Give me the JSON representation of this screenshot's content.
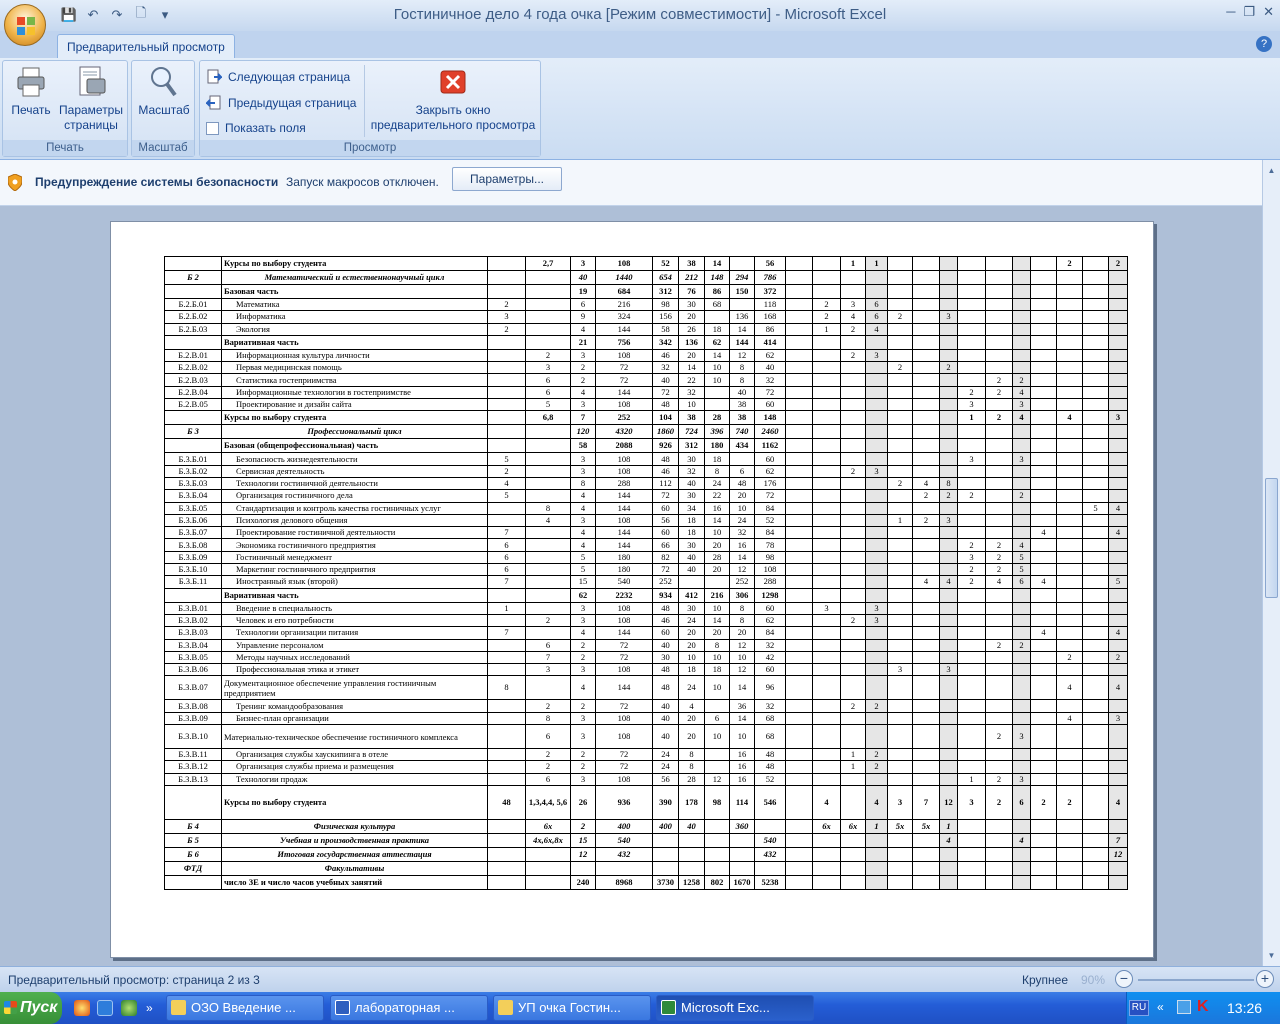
{
  "app": {
    "title": "Гостиничное дело 4 года очка  [Режим совместимости] - Microsoft Excel",
    "help": "?"
  },
  "ribbon": {
    "tab": "Предварительный просмотр",
    "groups": {
      "print": "Печать",
      "scale": "Масштаб",
      "view": "Просмотр"
    },
    "buttons": {
      "print": "Печать",
      "page_setup_1": "Параметры",
      "page_setup_2": "страницы",
      "zoom": "Масштаб",
      "next_page": "Следующая страница",
      "prev_page": "Предыдущая страница",
      "show_margins": "Показать поля",
      "close_1": "Закрыть окно",
      "close_2": "предварительного просмотра"
    }
  },
  "security": {
    "title": "Предупреждение системы безопасности",
    "text": "Запуск макросов отключен.",
    "button": "Параметры..."
  },
  "rows": [
    {
      "s": "b",
      "c": [
        "",
        "Курсы по выбору студента",
        "",
        "2,7",
        "3",
        "108",
        "52",
        "38",
        "14",
        "",
        "56",
        "",
        "",
        "1",
        "1",
        "",
        "",
        "",
        "",
        "",
        "",
        "",
        "2",
        "",
        "2"
      ]
    },
    {
      "s": "it",
      "c": [
        "Б 2",
        "Математический и естественнонаучный цикл",
        "",
        "",
        "40",
        "1440",
        "654",
        "212",
        "148",
        "294",
        "786",
        "",
        "",
        "",
        "",
        "",
        "",
        "",
        "",
        "",
        "",
        "",
        "",
        "",
        ""
      ]
    },
    {
      "s": "b",
      "c": [
        "",
        "Базовая часть",
        "",
        "",
        "19",
        "684",
        "312",
        "76",
        "86",
        "150",
        "372",
        "",
        "",
        "",
        "",
        "",
        "",
        "",
        "",
        "",
        "",
        "",
        "",
        "",
        ""
      ]
    },
    {
      "s": "",
      "c": [
        "Б.2.Б.01",
        "Математика",
        "2",
        "",
        "6",
        "216",
        "98",
        "30",
        "68",
        "",
        "118",
        "",
        "2",
        "3",
        "6",
        "",
        "",
        "",
        "",
        "",
        "",
        "",
        "",
        "",
        ""
      ]
    },
    {
      "s": "",
      "c": [
        "Б.2.Б.02",
        "Информатика",
        "3",
        "",
        "9",
        "324",
        "156",
        "20",
        "",
        "136",
        "168",
        "",
        "2",
        "4",
        "6",
        "2",
        "",
        "3",
        "",
        "",
        "",
        "",
        "",
        "",
        ""
      ]
    },
    {
      "s": "",
      "c": [
        "Б.2.Б.03",
        "Экология",
        "2",
        "",
        "4",
        "144",
        "58",
        "26",
        "18",
        "14",
        "86",
        "",
        "1",
        "2",
        "4",
        "",
        "",
        "",
        "",
        "",
        "",
        "",
        "",
        "",
        ""
      ]
    },
    {
      "s": "b",
      "c": [
        "",
        "Вариативная часть",
        "",
        "",
        "21",
        "756",
        "342",
        "136",
        "62",
        "144",
        "414",
        "",
        "",
        "",
        "",
        "",
        "",
        "",
        "",
        "",
        "",
        "",
        "",
        "",
        ""
      ]
    },
    {
      "s": "",
      "c": [
        "Б.2.В.01",
        "Информационная культура личности",
        "",
        "2",
        "3",
        "108",
        "46",
        "20",
        "14",
        "12",
        "62",
        "",
        "",
        "2",
        "3",
        "",
        "",
        "",
        "",
        "",
        "",
        "",
        "",
        "",
        ""
      ]
    },
    {
      "s": "",
      "c": [
        "Б.2.В.02",
        "Первая медицинская помощь",
        "",
        "3",
        "2",
        "72",
        "32",
        "14",
        "10",
        "8",
        "40",
        "",
        "",
        "",
        "",
        "2",
        "",
        "2",
        "",
        "",
        "",
        "",
        "",
        "",
        ""
      ]
    },
    {
      "s": "",
      "c": [
        "Б.2.В.03",
        "Статистика гостеприимства",
        "",
        "6",
        "2",
        "72",
        "40",
        "22",
        "10",
        "8",
        "32",
        "",
        "",
        "",
        "",
        "",
        "",
        "",
        "",
        "2",
        "2",
        "",
        "",
        "",
        ""
      ]
    },
    {
      "s": "",
      "c": [
        "Б.2.В.04",
        "Информационные технологии в гостеприимстве",
        "",
        "6",
        "4",
        "144",
        "72",
        "32",
        "",
        "40",
        "72",
        "",
        "",
        "",
        "",
        "",
        "",
        "",
        "2",
        "2",
        "4",
        "",
        "",
        "",
        ""
      ]
    },
    {
      "s": "",
      "c": [
        "Б.2.В.05",
        "Проектирование и дизайн сайта",
        "",
        "5",
        "3",
        "108",
        "48",
        "10",
        "",
        "38",
        "60",
        "",
        "",
        "",
        "",
        "",
        "",
        "",
        "3",
        "",
        "3",
        "",
        "",
        "",
        ""
      ]
    },
    {
      "s": "b",
      "c": [
        "",
        "Курсы по выбору студента",
        "",
        "6,8",
        "7",
        "252",
        "104",
        "38",
        "28",
        "38",
        "148",
        "",
        "",
        "",
        "",
        "",
        "",
        "",
        "1",
        "2",
        "4",
        "",
        "4",
        "",
        "3"
      ]
    },
    {
      "s": "it",
      "c": [
        "Б 3",
        "Профессиональный цикл",
        "",
        "",
        "120",
        "4320",
        "1860",
        "724",
        "396",
        "740",
        "2460",
        "",
        "",
        "",
        "",
        "",
        "",
        "",
        "",
        "",
        "",
        "",
        "",
        "",
        ""
      ]
    },
    {
      "s": "b",
      "c": [
        "",
        "Базовая (общепрофессиональная) часть",
        "",
        "",
        "58",
        "2088",
        "926",
        "312",
        "180",
        "434",
        "1162",
        "",
        "",
        "",
        "",
        "",
        "",
        "",
        "",
        "",
        "",
        "",
        "",
        "",
        ""
      ]
    },
    {
      "s": "",
      "c": [
        "Б.3.Б.01",
        "Безопасность жизнедеятельности",
        "5",
        "",
        "3",
        "108",
        "48",
        "30",
        "18",
        "",
        "60",
        "",
        "",
        "",
        "",
        "",
        "",
        "",
        "3",
        "",
        "3",
        "",
        "",
        "",
        ""
      ]
    },
    {
      "s": "",
      "c": [
        "Б.3.Б.02",
        "Сервисная деятельность",
        "2",
        "",
        "3",
        "108",
        "46",
        "32",
        "8",
        "6",
        "62",
        "",
        "",
        "2",
        "3",
        "",
        "",
        "",
        "",
        "",
        "",
        "",
        "",
        "",
        ""
      ]
    },
    {
      "s": "",
      "c": [
        "Б.3.Б.03",
        "Технологии гостиничной деятельности",
        "4",
        "",
        "8",
        "288",
        "112",
        "40",
        "24",
        "48",
        "176",
        "",
        "",
        "",
        "",
        "2",
        "4",
        "8",
        "",
        "",
        "",
        "",
        "",
        "",
        ""
      ]
    },
    {
      "s": "",
      "c": [
        "Б.3.Б.04",
        "Организация гостиничного дела",
        "5",
        "",
        "4",
        "144",
        "72",
        "30",
        "22",
        "20",
        "72",
        "",
        "",
        "",
        "",
        "",
        "2",
        "2",
        "2",
        "",
        "2",
        "",
        "",
        "",
        ""
      ]
    },
    {
      "s": "",
      "c": [
        "Б.3.Б.05",
        "Стандартизация и контроль качества гостиничных услуг",
        "",
        "8",
        "4",
        "144",
        "60",
        "34",
        "16",
        "10",
        "84",
        "",
        "",
        "",
        "",
        "",
        "",
        "",
        "",
        "",
        "",
        "",
        "",
        "5",
        "4"
      ]
    },
    {
      "s": "",
      "c": [
        "Б.3.Б.06",
        "Психология делового общения",
        "",
        "4",
        "3",
        "108",
        "56",
        "18",
        "14",
        "24",
        "52",
        "",
        "",
        "",
        "",
        "1",
        "2",
        "3",
        "",
        "",
        "",
        "",
        "",
        "",
        ""
      ]
    },
    {
      "s": "",
      "c": [
        "Б.3.Б.07",
        "Проектирование гостиничной деятельности",
        "7",
        "",
        "4",
        "144",
        "60",
        "18",
        "10",
        "32",
        "84",
        "",
        "",
        "",
        "",
        "",
        "",
        "",
        "",
        "",
        "",
        "4",
        "",
        "",
        "4"
      ]
    },
    {
      "s": "",
      "c": [
        "Б.3.Б.08",
        "Экономика гостиничного предприятия",
        "6",
        "",
        "4",
        "144",
        "66",
        "30",
        "20",
        "16",
        "78",
        "",
        "",
        "",
        "",
        "",
        "",
        "",
        "2",
        "2",
        "4",
        "",
        "",
        "",
        ""
      ]
    },
    {
      "s": "",
      "c": [
        "Б.3.Б.09",
        "Гостиничный менеджмент",
        "6",
        "",
        "5",
        "180",
        "82",
        "40",
        "28",
        "14",
        "98",
        "",
        "",
        "",
        "",
        "",
        "",
        "",
        "3",
        "2",
        "5",
        "",
        "",
        "",
        ""
      ]
    },
    {
      "s": "",
      "c": [
        "Б.3.Б.10",
        "Маркетинг гостиничного предприятия",
        "6",
        "",
        "5",
        "180",
        "72",
        "40",
        "20",
        "12",
        "108",
        "",
        "",
        "",
        "",
        "",
        "",
        "",
        "2",
        "2",
        "5",
        "",
        "",
        "",
        ""
      ]
    },
    {
      "s": "",
      "c": [
        "Б.3.Б.11",
        "Иностранный язык (второй)",
        "7",
        "",
        "15",
        "540",
        "252",
        "",
        "",
        "252",
        "288",
        "",
        "",
        "",
        "",
        "",
        "4",
        "4",
        "2",
        "4",
        "6",
        "4",
        "",
        "",
        "5"
      ]
    },
    {
      "s": "b",
      "c": [
        "",
        "Вариативная часть",
        "",
        "",
        "62",
        "2232",
        "934",
        "412",
        "216",
        "306",
        "1298",
        "",
        "",
        "",
        "",
        "",
        "",
        "",
        "",
        "",
        "",
        "",
        "",
        "",
        ""
      ]
    },
    {
      "s": "",
      "c": [
        "Б.3.В.01",
        "Введение в специальность",
        "1",
        "",
        "3",
        "108",
        "48",
        "30",
        "10",
        "8",
        "60",
        "",
        "3",
        "",
        "3",
        "",
        "",
        "",
        "",
        "",
        "",
        "",
        "",
        "",
        ""
      ]
    },
    {
      "s": "",
      "c": [
        "Б.3.В.02",
        "Человек и его потребности",
        "",
        "2",
        "3",
        "108",
        "46",
        "24",
        "14",
        "8",
        "62",
        "",
        "",
        "2",
        "3",
        "",
        "",
        "",
        "",
        "",
        "",
        "",
        "",
        "",
        ""
      ]
    },
    {
      "s": "",
      "c": [
        "Б.3.В.03",
        "Технологии организации питания",
        "7",
        "",
        "4",
        "144",
        "60",
        "20",
        "20",
        "20",
        "84",
        "",
        "",
        "",
        "",
        "",
        "",
        "",
        "",
        "",
        "",
        "4",
        "",
        "",
        "4"
      ]
    },
    {
      "s": "",
      "c": [
        "Б.3.В.04",
        "Управление персоналом",
        "",
        "6",
        "2",
        "72",
        "40",
        "20",
        "8",
        "12",
        "32",
        "",
        "",
        "",
        "",
        "",
        "",
        "",
        "",
        "2",
        "2",
        "",
        "",
        "",
        ""
      ]
    },
    {
      "s": "",
      "c": [
        "Б.3.В.05",
        "Методы научных исследований",
        "",
        "7",
        "2",
        "72",
        "30",
        "10",
        "10",
        "10",
        "42",
        "",
        "",
        "",
        "",
        "",
        "",
        "",
        "",
        "",
        "",
        "",
        "2",
        "",
        "2"
      ]
    },
    {
      "s": "",
      "c": [
        "Б.3.В.06",
        "Профессиональная этика и этикет",
        "",
        "3",
        "3",
        "108",
        "48",
        "18",
        "18",
        "12",
        "60",
        "",
        "",
        "",
        "",
        "3",
        "",
        "3",
        "",
        "",
        "",
        "",
        "",
        "",
        ""
      ]
    },
    {
      "s": "tall",
      "c": [
        "Б.3.В.07",
        "Документационное обеспечение управления гостиничным предприятием",
        "8",
        "",
        "4",
        "144",
        "48",
        "24",
        "10",
        "14",
        "96",
        "",
        "",
        "",
        "",
        "",
        "",
        "",
        "",
        "",
        "",
        "",
        "4",
        "",
        "4"
      ]
    },
    {
      "s": "",
      "c": [
        "Б.3.В.08",
        "Тренинг командообразования",
        "",
        "2",
        "2",
        "72",
        "40",
        "4",
        "",
        "36",
        "32",
        "",
        "",
        "2",
        "2",
        "",
        "",
        "",
        "",
        "",
        "",
        "",
        "",
        "",
        ""
      ]
    },
    {
      "s": "",
      "c": [
        "Б.3.В.09",
        "Бизнес-план организации",
        "",
        "8",
        "3",
        "108",
        "40",
        "20",
        "6",
        "14",
        "68",
        "",
        "",
        "",
        "",
        "",
        "",
        "",
        "",
        "",
        "",
        "",
        "4",
        "",
        "3"
      ]
    },
    {
      "s": "tall",
      "c": [
        "Б.3.В.10",
        "Материально-техническое обеспечение гостиничного комплекса",
        "",
        "6",
        "3",
        "108",
        "40",
        "20",
        "10",
        "10",
        "68",
        "",
        "",
        "",
        "",
        "",
        "",
        "",
        "",
        "2",
        "3",
        "",
        "",
        "",
        ""
      ]
    },
    {
      "s": "",
      "c": [
        "Б.3.В.11",
        "Организация службы хаускипинга в отеле",
        "",
        "2",
        "2",
        "72",
        "24",
        "8",
        "",
        "16",
        "48",
        "",
        "",
        "1",
        "2",
        "",
        "",
        "",
        "",
        "",
        "",
        "",
        "",
        "",
        ""
      ]
    },
    {
      "s": "",
      "c": [
        "Б.3.В.12",
        "Организация службы приема и размещения",
        "",
        "2",
        "2",
        "72",
        "24",
        "8",
        "",
        "16",
        "48",
        "",
        "",
        "1",
        "2",
        "",
        "",
        "",
        "",
        "",
        "",
        "",
        "",
        "",
        ""
      ]
    },
    {
      "s": "",
      "c": [
        "Б.3.В.13",
        "Технологии продаж",
        "",
        "6",
        "3",
        "108",
        "56",
        "28",
        "12",
        "16",
        "52",
        "",
        "",
        "",
        "",
        "",
        "",
        "",
        "1",
        "2",
        "3",
        "",
        "",
        "",
        ""
      ]
    },
    {
      "s": "big",
      "c": [
        "",
        "Курсы по выбору студента",
        "48",
        "1,3,4,4, 5,6",
        "26",
        "936",
        "390",
        "178",
        "98",
        "114",
        "546",
        "",
        "4",
        "",
        "4",
        "3",
        "7",
        "12",
        "3",
        "2",
        "6",
        "2",
        "2",
        "",
        "4"
      ]
    },
    {
      "s": "it",
      "c": [
        "Б 4",
        "Физическая культура",
        "",
        "6х",
        "2",
        "400",
        "400",
        "40",
        "",
        "360",
        "",
        "",
        "6х",
        "6х",
        "1",
        "5х",
        "5х",
        "1",
        "",
        "",
        "",
        "",
        "",
        "",
        ""
      ]
    },
    {
      "s": "it",
      "c": [
        "Б 5",
        "Учебная и производственная практика",
        "",
        "4х,6х,8х",
        "15",
        "540",
        "",
        "",
        "",
        "",
        "540",
        "",
        "",
        "",
        "",
        "",
        "",
        "4",
        "",
        "",
        "4",
        "",
        "",
        "",
        "7"
      ]
    },
    {
      "s": "it",
      "c": [
        "Б 6",
        "Итоговая государственная аттестация",
        "",
        "",
        "12",
        "432",
        "",
        "",
        "",
        "",
        "432",
        "",
        "",
        "",
        "",
        "",
        "",
        "",
        "",
        "",
        "",
        "",
        "",
        "",
        "12"
      ]
    },
    {
      "s": "it",
      "c": [
        "ФТД",
        "Факультативы",
        "",
        "",
        "",
        "",
        "",
        "",
        "",
        "",
        "",
        "",
        "",
        "",
        "",
        "",
        "",
        "",
        "",
        "",
        "",
        "",
        "",
        "",
        ""
      ]
    },
    {
      "s": "b",
      "c": [
        "",
        "число ЗЕ и число часов учебных занятий",
        "",
        "",
        "240",
        "8968",
        "3730",
        "1258",
        "802",
        "1670",
        "5238",
        "",
        "",
        "",
        "",
        "",
        "",
        "",
        "",
        "",
        "",
        "",
        "",
        "",
        ""
      ]
    }
  ],
  "status": {
    "text": "Предварительный просмотр: страница 2 из 3",
    "zoom_label": "Крупнее",
    "zoom": "90%"
  },
  "taskbar": {
    "start": "Пуск",
    "tasks": [
      "ОЗО Введение ...",
      "лабораторная ...",
      "УП очка Гостин...",
      "Microsoft Exc..."
    ],
    "lang": "RU",
    "time": "13:26"
  }
}
